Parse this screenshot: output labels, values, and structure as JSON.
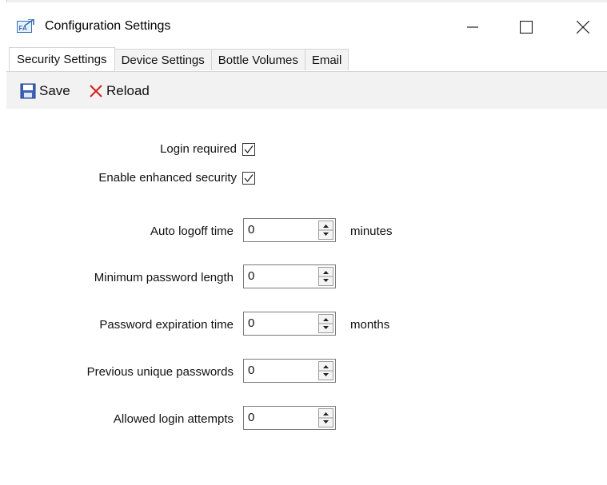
{
  "window": {
    "title": "Configuration Settings",
    "app_icon": "fa-app-icon",
    "controls": [
      "minimize-icon",
      "maximize-icon",
      "close-icon"
    ]
  },
  "tabs": [
    {
      "label": "Security Settings",
      "active": true
    },
    {
      "label": "Device Settings",
      "active": false
    },
    {
      "label": "Bottle Volumes",
      "active": false
    },
    {
      "label": "Email",
      "active": false
    }
  ],
  "toolbar": {
    "save_label": "Save",
    "reload_label": "Reload",
    "save_color": "#2b4f9e",
    "reload_color": "#d32020"
  },
  "security": {
    "login_required": {
      "label": "Login required",
      "checked": true
    },
    "enhanced_security": {
      "label": "Enable enhanced security",
      "checked": true
    },
    "auto_logoff": {
      "label": "Auto logoff time",
      "value": "0",
      "unit": "minutes"
    },
    "min_password_length": {
      "label": "Minimum password length",
      "value": "0"
    },
    "password_expiration": {
      "label": "Password expiration time",
      "value": "0",
      "unit": "months"
    },
    "previous_unique": {
      "label": "Previous unique passwords",
      "value": "0"
    },
    "login_attempts": {
      "label": "Allowed login attempts",
      "value": "0"
    }
  }
}
